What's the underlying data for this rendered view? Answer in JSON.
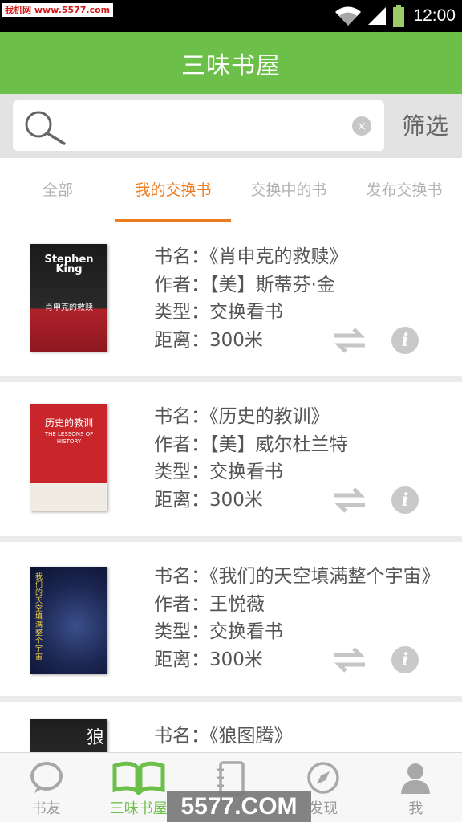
{
  "status_bar": {
    "watermark": "我机网 www.5577.com",
    "time": "12:00"
  },
  "header": {
    "title": "三味书屋"
  },
  "search": {
    "placeholder": "",
    "value": "",
    "clear_icon": "clear-icon",
    "filter_label": "筛选"
  },
  "tabs": [
    {
      "label": "全部",
      "active": false
    },
    {
      "label": "我的交换书",
      "active": true
    },
    {
      "label": "交换中的书",
      "active": false
    },
    {
      "label": "发布交换书",
      "active": false
    }
  ],
  "books": [
    {
      "title_line": "书名：《肖申克的救赎》",
      "author_line": "作者：【美】斯蒂芬·金",
      "type_line": "类型：交换看书",
      "distance_line": "距离：300米",
      "cover_text": "Stephen King",
      "cover_subtext": "肖申克的救赎"
    },
    {
      "title_line": "书名：《历史的教训》",
      "author_line": "作者：【美】威尔杜兰特",
      "type_line": "类型：交换看书",
      "distance_line": "距离：300米",
      "cover_text": "历史的教训",
      "cover_subtext": "THE LESSONS OF HISTORY"
    },
    {
      "title_line": "书名：《我们的天空填满整个宇宙》",
      "author_line": "作者：王悦薇",
      "type_line": "类型：交换看书",
      "distance_line": "距离：300米",
      "cover_text": "我们的天空填满整个宇宙",
      "cover_subtext": ""
    },
    {
      "title_line": "书名：《狼图腾》",
      "author_line": "",
      "type_line": "",
      "distance_line": "",
      "cover_text": "狼",
      "cover_subtext": ""
    }
  ],
  "bottom_nav": [
    {
      "label": "书友",
      "icon": "chat-bubble-icon",
      "active": false
    },
    {
      "label": "三味书屋",
      "icon": "open-book-icon",
      "active": true
    },
    {
      "label": "",
      "icon": "notebook-icon",
      "active": false
    },
    {
      "label": "发现",
      "icon": "compass-icon",
      "active": false
    },
    {
      "label": "我",
      "icon": "person-icon",
      "active": false
    }
  ],
  "watermark_bottom": "5577.COM",
  "colors": {
    "header_green": "#6cc04a",
    "tab_orange": "#ec7d1f",
    "nav_active": "#6cc04a"
  }
}
